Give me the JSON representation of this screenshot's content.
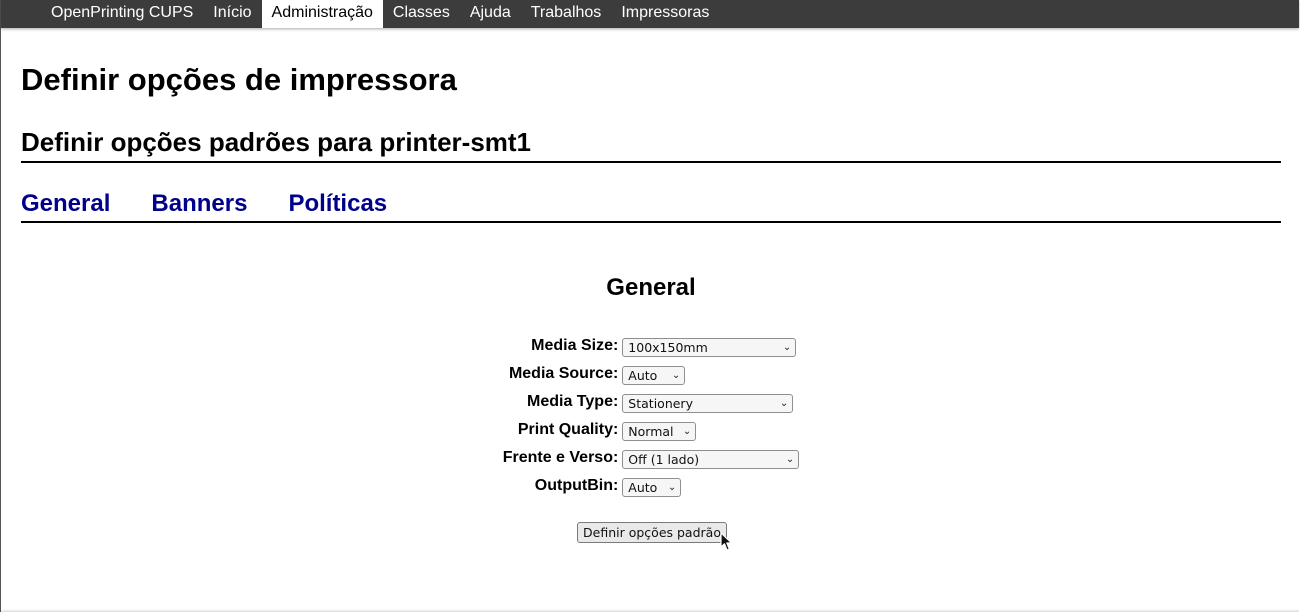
{
  "nav": {
    "items": [
      {
        "label": "OpenPrinting CUPS"
      },
      {
        "label": "Início"
      },
      {
        "label": "Administração"
      },
      {
        "label": "Classes"
      },
      {
        "label": "Ajuda"
      },
      {
        "label": "Trabalhos"
      },
      {
        "label": "Impressoras"
      }
    ],
    "active": "Administração"
  },
  "page": {
    "title": "Definir opções de impressora",
    "subtitle": "Definir opções padrões para printer-smt1"
  },
  "tabs": [
    {
      "label": "General"
    },
    {
      "label": "Banners"
    },
    {
      "label": "Políticas"
    }
  ],
  "section": {
    "title": "General"
  },
  "options": [
    {
      "label": "Media Size:",
      "value": "100x150mm"
    },
    {
      "label": "Media Source:",
      "value": "Auto"
    },
    {
      "label": "Media Type:",
      "value": "Stationery"
    },
    {
      "label": "Print Quality:",
      "value": "Normal"
    },
    {
      "label": "Frente e Verso:",
      "value": "Off (1 lado)"
    },
    {
      "label": "OutputBin:",
      "value": "Auto"
    }
  ],
  "submit": {
    "label": "Definir opções padrão"
  },
  "colors": {
    "nav_bg": "#3c3c3c",
    "tab_link": "#00008b"
  },
  "icons": {
    "dropdown": "chevron-down-icon",
    "cursor": "mouse-pointer-icon"
  }
}
